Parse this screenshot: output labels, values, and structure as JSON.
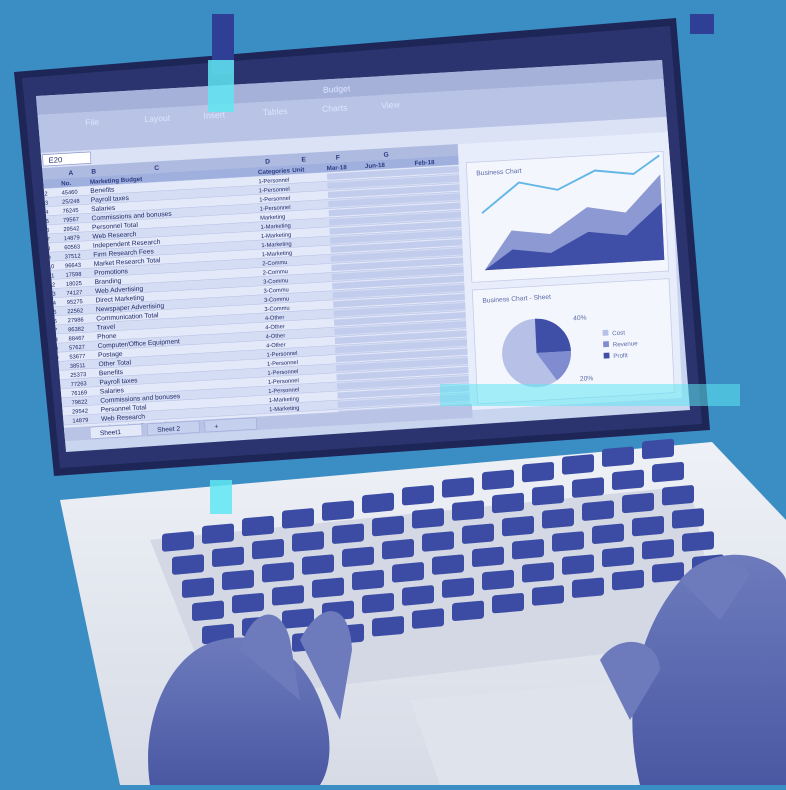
{
  "window": {
    "title": "Budget"
  },
  "ribbon_tabs": [
    "File",
    "Layout",
    "Insert",
    "Tables",
    "Charts",
    "View"
  ],
  "sheet": {
    "columns": [
      "A",
      "B",
      "C",
      "D",
      "E",
      "F",
      "G",
      "H",
      "I",
      "J",
      "K"
    ],
    "name_box": "E20",
    "headers": [
      "No.",
      "Marketing Budget",
      "Categories",
      "Unit",
      "Mar-18",
      "Jun-18",
      "Feb-18"
    ],
    "rows": [
      [
        "45460",
        "Benefits",
        "1-Personnel"
      ],
      [
        "25/248",
        "Payroll taxes",
        "1-Personnel"
      ],
      [
        "76245",
        "Salaries",
        "1-Personnel"
      ],
      [
        "79567",
        "Commissions and bonuses",
        "1-Personnel"
      ],
      [
        "29542",
        "Personnel Total",
        "Marketing"
      ],
      [
        "14879",
        "Web Research",
        "1-Marketing"
      ],
      [
        "60563",
        "Independent Research",
        "1-Marketing"
      ],
      [
        "37512",
        "Firm Research Fees",
        "1-Marketing"
      ],
      [
        "96643",
        "Market Research Total",
        "1-Marketing"
      ],
      [
        "17598",
        "Promotions",
        "2-Commu"
      ],
      [
        "18025",
        "Branding",
        "2-Commu"
      ],
      [
        "74127",
        "Web Advertising",
        "3-Commu"
      ],
      [
        "95275",
        "Direct Marketing",
        "3-Commu"
      ],
      [
        "22562",
        "Newspaper Advertising",
        "3-Commu"
      ],
      [
        "27986",
        "Communication Total",
        "3-Commu"
      ],
      [
        "86382",
        "Travel",
        "4-Other"
      ],
      [
        "88467",
        "Phone",
        "4-Other"
      ],
      [
        "57627",
        "Computer/Office Equipment",
        "4-Other"
      ],
      [
        "53677",
        "Postage",
        "4-Other"
      ],
      [
        "38511",
        "Other Total",
        "1-Personnel"
      ],
      [
        "25373",
        "Benefits",
        "1-Personnel"
      ],
      [
        "77263",
        "Payroll taxes",
        "1-Personnel"
      ],
      [
        "76169",
        "Salaries",
        "1-Personnel"
      ],
      [
        "79622",
        "Commissions and bonuses",
        "1-Personnel"
      ],
      [
        "29542",
        "Personnel Total",
        "1-Marketing"
      ],
      [
        "14879",
        "Web Research",
        "1-Marketing"
      ],
      [
        "60563",
        "Independent Research",
        "1-Marketing"
      ]
    ],
    "tabs": [
      "Sheet1",
      "Sheet 2",
      "+"
    ]
  },
  "charts": {
    "area_title": "Business Chart",
    "pie_title": "Business Chart - Sheet",
    "pie_labels": [
      "40%",
      "20%"
    ],
    "legend": [
      "Cost",
      "Revenue",
      "Profit"
    ]
  },
  "colors": {
    "background": "#3b8ec4",
    "screen": "#c9d4ef",
    "laptop_body": "#e9ecf1",
    "keys": "#3c4ca4",
    "hands": "#5f6cae",
    "accent_cyan": "#5fe6f2"
  }
}
